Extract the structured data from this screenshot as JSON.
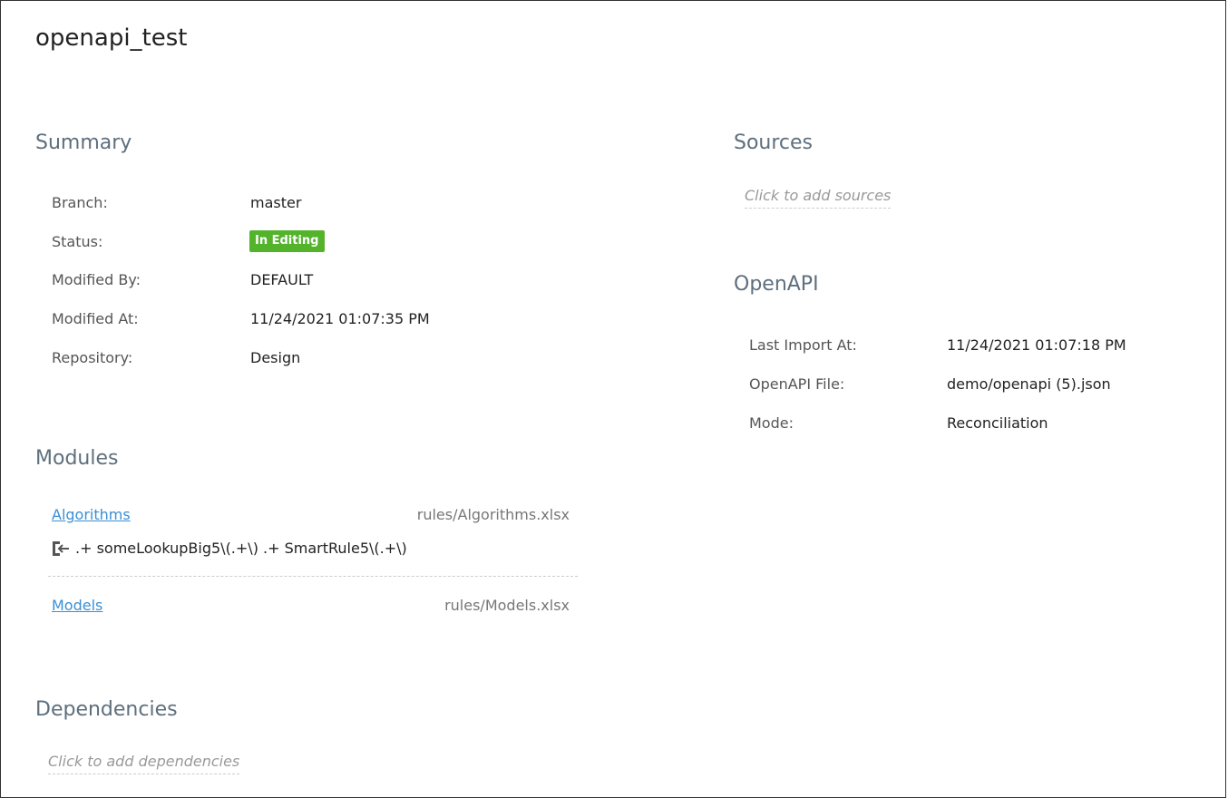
{
  "page": {
    "title": "openapi_test"
  },
  "summary": {
    "heading": "Summary",
    "rows": [
      {
        "label": "Branch:",
        "value": "master"
      },
      {
        "label": "Status:",
        "value": "In Editing"
      },
      {
        "label": "Modified By:",
        "value": "DEFAULT"
      },
      {
        "label": "Modified At:",
        "value": "11/24/2021 01:07:35 PM"
      },
      {
        "label": "Repository:",
        "value": "Design"
      }
    ],
    "status_color": "#53b42c"
  },
  "modules": {
    "heading": "Modules",
    "items": [
      {
        "name": "Algorithms",
        "path": "rules/Algorithms.xlsx",
        "pattern": ".+ someLookupBig5\\(.+\\) .+ SmartRule5\\(.+\\)",
        "pattern_icon": "import-icon"
      },
      {
        "name": "Models",
        "path": "rules/Models.xlsx"
      }
    ]
  },
  "dependencies": {
    "heading": "Dependencies",
    "placeholder": "Click to add dependencies"
  },
  "sources": {
    "heading": "Sources",
    "placeholder": "Click to add sources"
  },
  "openapi": {
    "heading": "OpenAPI",
    "rows": [
      {
        "label": "Last Import At:",
        "value": "11/24/2021 01:07:18 PM"
      },
      {
        "label": "OpenAPI File:",
        "value": "demo/openapi (5).json"
      },
      {
        "label": "Mode:",
        "value": "Reconciliation"
      }
    ]
  }
}
